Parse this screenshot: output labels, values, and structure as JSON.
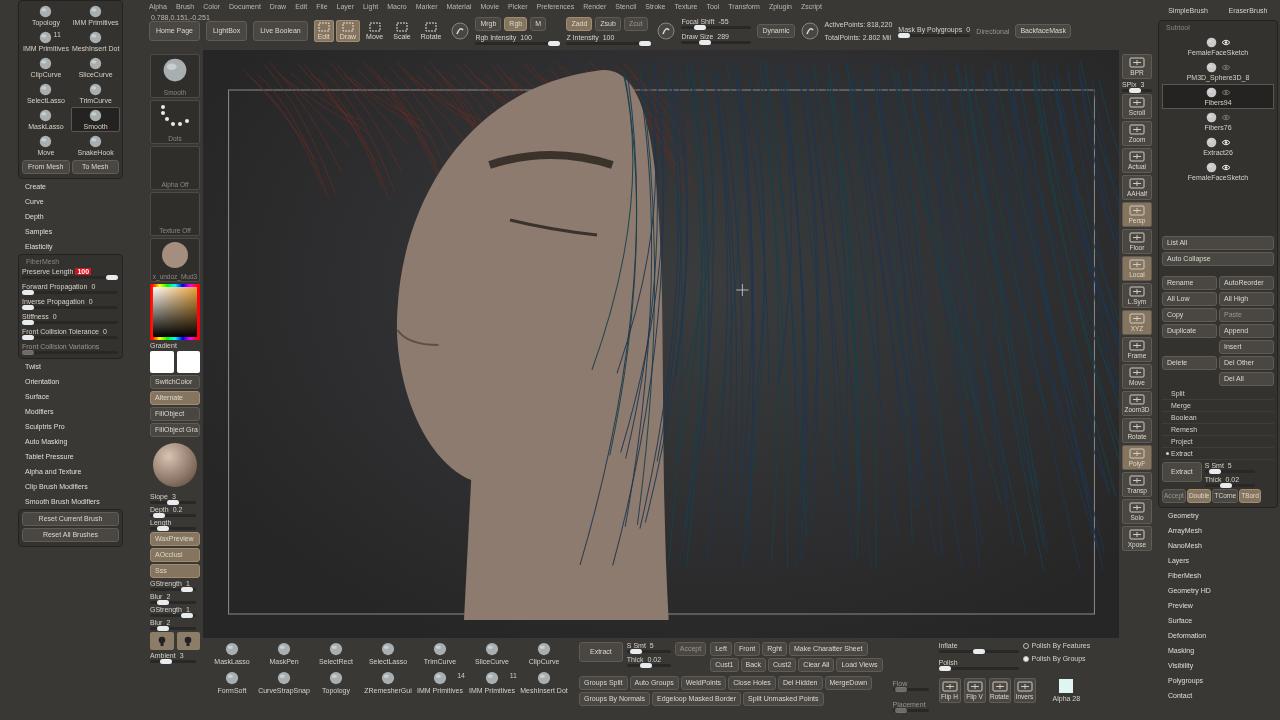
{
  "menu_bar": {
    "items": [
      "Alpha",
      "Brush",
      "Color",
      "Document",
      "Draw",
      "Edit",
      "File",
      "Layer",
      "Light",
      "Macro",
      "Marker",
      "Material",
      "Movie",
      "Picker",
      "Preferences",
      "Render",
      "Stencil",
      "Stroke",
      "Texture",
      "Tool",
      "Transform",
      "Zplugin",
      "Zscript"
    ]
  },
  "coordinates": "0.788,0.151,-0.251",
  "brush_palette": {
    "items": [
      {
        "label": "Topology",
        "selected": false
      },
      {
        "label": "IMM Primitives",
        "selected": false
      },
      {
        "label": "IMM Primitives",
        "badge": "11",
        "selected": false
      },
      {
        "label": "MeshInsert Dot",
        "selected": false
      },
      {
        "label": "ClipCurve",
        "selected": false
      },
      {
        "label": "SliceCurve",
        "selected": false
      },
      {
        "label": "SelectLasso",
        "selected": false
      },
      {
        "label": "TrimCurve",
        "selected": false
      },
      {
        "label": "MaskLasso",
        "selected": false
      },
      {
        "label": "Smooth",
        "selected": true
      },
      {
        "label": "Move",
        "selected": false
      },
      {
        "label": "SnakeHook",
        "selected": false
      }
    ],
    "buttons": [
      "From Mesh",
      "To Mesh"
    ]
  },
  "brush_sections_top": [
    "Create",
    "Curve",
    "Depth",
    "Samples",
    "Elasticity"
  ],
  "fibermesh": {
    "title": "FiberMesh",
    "sliders": [
      {
        "label": "Preserve Length",
        "value": "100",
        "level": 1,
        "highlighted": true,
        "disabled": false
      },
      {
        "label": "Forward Propagation",
        "value": "0",
        "level": 0,
        "highlighted": false,
        "disabled": false
      },
      {
        "label": "Inverse Propagation",
        "value": "0",
        "level": 0,
        "highlighted": false,
        "disabled": false
      },
      {
        "label": "Stiffness",
        "value": "0",
        "level": 0,
        "highlighted": false,
        "disabled": false
      },
      {
        "label": "Front Collision Tolerance",
        "value": "0",
        "level": 0,
        "highlighted": false,
        "disabled": false
      },
      {
        "label": "Front Collision Variations",
        "level": 0,
        "disabled": true
      }
    ]
  },
  "brush_sections_bottom": [
    "Twist",
    "Orientation",
    "Surface",
    "Modifiers",
    "Sculptris Pro",
    "Auto Masking",
    "Tablet Pressure",
    "Alpha and Texture",
    "Clip Brush Modifiers",
    "Smooth Brush Modifiers"
  ],
  "reset_buttons": [
    "Reset Current Brush",
    "Reset All Brushes"
  ],
  "shelf": {
    "nav": [
      "Home Page",
      "LightBox",
      "Live Boolean"
    ],
    "modes": [
      {
        "label": "Edit",
        "selected": true
      },
      {
        "label": "Draw",
        "selected": true
      },
      {
        "label": "Move",
        "selected": false
      },
      {
        "label": "Scale",
        "selected": false
      },
      {
        "label": "Rotate",
        "selected": false
      }
    ],
    "color_modes": [
      {
        "label": "Mrgb",
        "selected": false
      },
      {
        "label": "Rgb",
        "selected": true
      },
      {
        "label": "M",
        "selected": false
      }
    ],
    "z_modes": [
      {
        "label": "Zadd",
        "selected": true,
        "disabled": false
      },
      {
        "label": "Zsub",
        "selected": false,
        "disabled": false
      },
      {
        "label": "Zcut",
        "selected": false,
        "disabled": true
      }
    ],
    "intensity": [
      {
        "label": "Rgb Intensity",
        "value": "100",
        "level": 1
      },
      {
        "label": "Z Intensity",
        "value": "100",
        "level": 1
      }
    ],
    "brush_size": [
      {
        "label": "Focal Shift",
        "value": "-55",
        "level": 0.22
      },
      {
        "label": "Draw Size",
        "value": "289",
        "level": 0.3
      }
    ],
    "dynamic": "Dynamic",
    "stats": [
      "ActivePoints: 818,220",
      "TotalPoints: 2.802 Mil"
    ],
    "mask": {
      "label": "Mask By Polygroups",
      "value": "0",
      "level": 0
    },
    "directional": "Directional",
    "backface": "BackfaceMask"
  },
  "top_brushes": [
    "SimpleBrush",
    "EraserBrush"
  ],
  "left_shelf": {
    "thumbs": [
      {
        "label": "Smooth",
        "kind": "brush"
      },
      {
        "label": "Dots",
        "kind": "stroke"
      },
      {
        "label": "Alpha Off",
        "kind": "empty"
      },
      {
        "label": "Texture Off",
        "kind": "empty"
      },
      {
        "label": "x_undoz_Mud3",
        "kind": "material"
      }
    ],
    "gradient": "Gradient",
    "toggles": [
      {
        "label": "SwitchColor",
        "on": false
      },
      {
        "label": "Alternate",
        "on": true
      },
      {
        "label": "FillObject",
        "on": false
      },
      {
        "label": "FillObject Gra",
        "on": false
      }
    ],
    "controls": [
      {
        "kind": "slider",
        "label": "Slope",
        "value": "3",
        "level": 0.5
      },
      {
        "kind": "slider",
        "label": "Depth",
        "value": "0.2",
        "level": 0.1
      },
      {
        "kind": "slider",
        "label": "Length",
        "level": 0.2
      },
      {
        "kind": "toggle",
        "label": "WaxPreview",
        "on": true
      },
      {
        "kind": "toggle",
        "label": "AOcclusi",
        "on": true
      },
      {
        "kind": "toggle",
        "label": "Sss",
        "on": true
      },
      {
        "kind": "slider",
        "label": "GStrength",
        "value": "1",
        "level": 0.9
      },
      {
        "kind": "slider",
        "label": "Blur",
        "value": "2",
        "level": 0.2
      },
      {
        "kind": "slider",
        "label": "GStrength",
        "value": "1",
        "level": 0.9
      },
      {
        "kind": "slider",
        "label": "Blur",
        "value": "2",
        "level": 0.2
      }
    ],
    "ambient": {
      "label": "Ambient",
      "value": "3",
      "level": 0.3
    }
  },
  "view_tools": [
    {
      "kind": "button",
      "label": "BPR",
      "on": false
    },
    {
      "kind": "slider",
      "label": "SPix",
      "value": "3",
      "level": 0.4
    },
    {
      "kind": "button",
      "label": "Scroll",
      "on": false
    },
    {
      "kind": "button",
      "label": "Zoom",
      "on": false
    },
    {
      "kind": "button",
      "label": "Actual",
      "on": false
    },
    {
      "kind": "button",
      "label": "AAHalf",
      "on": false
    },
    {
      "kind": "button",
      "label": "Persp",
      "on": true
    },
    {
      "kind": "button",
      "label": "Floor",
      "on": false
    },
    {
      "kind": "button",
      "label": "Local",
      "on": true
    },
    {
      "kind": "button",
      "label": "L.Sym",
      "on": false
    },
    {
      "kind": "button",
      "label": "XYZ",
      "on": true
    },
    {
      "kind": "button",
      "label": "Frame",
      "on": false
    },
    {
      "kind": "button",
      "label": "Move",
      "on": false
    },
    {
      "kind": "button",
      "label": "Zoom3D",
      "on": false
    },
    {
      "kind": "button",
      "label": "Rotate",
      "on": false
    },
    {
      "kind": "button",
      "label": "PolyF",
      "on": true
    },
    {
      "kind": "button",
      "label": "Transp",
      "on": false
    },
    {
      "kind": "button",
      "label": "Solo",
      "on": false
    },
    {
      "kind": "button",
      "label": "Xpose",
      "on": false
    }
  ],
  "subtool": {
    "title": "Subtool",
    "items": [
      {
        "name": "FemaleFaceSketch",
        "selected": false,
        "visible": true
      },
      {
        "name": "PM3D_Sphere3D_8",
        "selected": false,
        "visible": false
      },
      {
        "name": "Fibers94",
        "selected": true,
        "visible": false
      },
      {
        "name": "Fibers76",
        "selected": false,
        "visible": false
      },
      {
        "name": "Extract26",
        "selected": false,
        "visible": true
      },
      {
        "name": "FemaleFaceSketch",
        "selected": false,
        "visible": true
      }
    ]
  },
  "list_buttons": [
    "List All",
    "Auto Collapse"
  ],
  "subtool_actions": [
    {
      "label": "Rename",
      "kind": "normal",
      "disabled": false
    },
    {
      "label": "AutoReorder",
      "kind": "normal",
      "disabled": false
    },
    {
      "label": "All Low",
      "kind": "normal",
      "disabled": false
    },
    {
      "label": "All High",
      "kind": "normal",
      "disabled": false
    },
    {
      "label": "Copy",
      "kind": "normal",
      "disabled": false
    },
    {
      "label": "Paste",
      "kind": "normal",
      "disabled": true
    },
    {
      "label": "Duplicate",
      "kind": "lead",
      "disabled": false
    },
    {
      "label": "Append",
      "kind": "normal",
      "disabled": false
    },
    {
      "label": "Insert",
      "kind": "side",
      "disabled": false
    },
    {
      "label": "Delete",
      "kind": "lead",
      "disabled": false
    },
    {
      "label": "Del Other",
      "kind": "normal",
      "disabled": false
    },
    {
      "label": "Del All",
      "kind": "side",
      "disabled": false
    }
  ],
  "subtool_sections": [
    {
      "label": "Split",
      "expanded": false
    },
    {
      "label": "Merge",
      "expanded": false
    },
    {
      "label": "Boolean",
      "expanded": false
    },
    {
      "label": "Remesh",
      "expanded": false
    },
    {
      "label": "Project",
      "expanded": false
    },
    {
      "label": "Extract",
      "expanded": true
    }
  ],
  "extract": {
    "button": "Extract",
    "sliders": [
      {
        "label": "S Smt",
        "value": "5",
        "level": 0.1
      },
      {
        "label": "Thick",
        "value": "0.02",
        "level": 0.4
      }
    ],
    "toggles": [
      {
        "label": "Accept",
        "on": false,
        "disabled": true
      },
      {
        "label": "Double",
        "on": true,
        "disabled": false
      },
      {
        "label": "TCorne",
        "on": false,
        "disabled": false
      },
      {
        "label": "TBord",
        "on": true,
        "disabled": false
      }
    ]
  },
  "tool_sections": [
    "Geometry",
    "ArrayMesh",
    "NanoMesh",
    "Layers",
    "FiberMesh",
    "Geometry HD",
    "Preview",
    "Surface",
    "Deformation",
    "Masking",
    "Visibility",
    "Polygroups",
    "Contact"
  ],
  "bottom_shelf": {
    "brush_rows": [
      {
        "items": [
          {
            "label": "MaskLasso"
          },
          {
            "label": "MaskPen"
          },
          {
            "label": "SelectRect"
          },
          {
            "label": "SelectLasso"
          },
          {
            "label": "TrimCurve"
          },
          {
            "label": "SliceCurve"
          },
          {
            "label": "ClipCurve"
          }
        ]
      },
      {
        "items": [
          {
            "label": "FormSoft"
          },
          {
            "label": "CurveStrapSnap"
          },
          {
            "label": "Topology"
          },
          {
            "label": "ZRemesherGui"
          },
          {
            "label": "IMM Primitives",
            "badge": "14"
          },
          {
            "label": "IMM Primitives",
            "badge": "11"
          },
          {
            "label": "MeshInsert Dot"
          }
        ]
      }
    ],
    "extract": {
      "button": "Extract",
      "sliders": [
        {
          "label": "S Smt",
          "value": "5",
          "level": 0.1
        },
        {
          "label": "Thick",
          "value": "0.02",
          "level": 0.4
        }
      ],
      "accept": {
        "label": "Accept",
        "disabled": true
      }
    },
    "view_rows": [
      {
        "items": [
          "Left",
          "Front",
          "Rght",
          "Make Charatter Sheet"
        ]
      },
      {
        "items": [
          "Cust1",
          "Back",
          "Cust2",
          "Clear All",
          "Load Views"
        ]
      }
    ],
    "group_rows": [
      {
        "items": [
          "Groups Split",
          "Auto Groups",
          "WeldPoints",
          "Close Holes",
          "Del Hidden",
          "MergeDown"
        ]
      },
      {
        "items": [
          "Groups By Normals",
          "Edgeloop Masked Border",
          "Split Unmasked Points"
        ]
      }
    ],
    "flow_sliders": [
      {
        "label": "Flow",
        "level": 0.1,
        "disabled": true
      },
      {
        "label": "Placement",
        "level": 0.1,
        "disabled": true
      }
    ],
    "polish_sliders": [
      {
        "label": "Inflate",
        "level": 0.5
      },
      {
        "label": "Polish",
        "level": 0
      }
    ],
    "polish_options": [
      {
        "label": "Polish By Features",
        "checked": false
      },
      {
        "label": "Polish By Groups",
        "checked": true
      }
    ],
    "flip_buttons": [
      "Flip H",
      "Flip V",
      "Rotate",
      "Invers"
    ],
    "alpha": "Alpha 28"
  }
}
